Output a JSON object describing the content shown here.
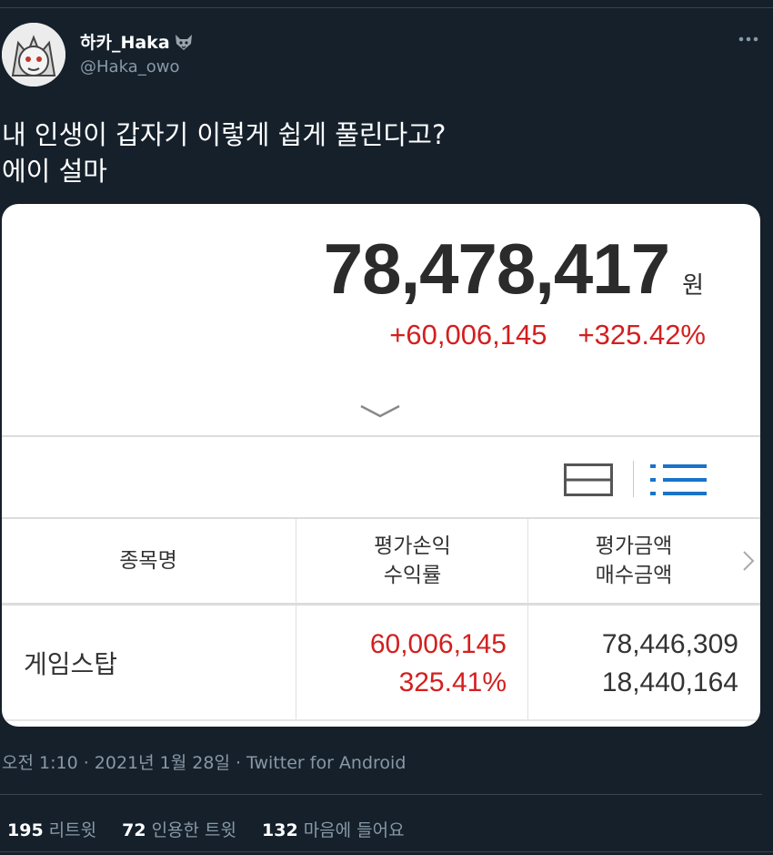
{
  "author": {
    "display_name": "하카_Haka",
    "handle": "@Haka_owo",
    "name_emoji": "wolf-icon"
  },
  "tweet": {
    "line1": "내 인생이 갑자기 이렇게 쉽게 풀린다고?",
    "line2": "에이 설마"
  },
  "card": {
    "total_amount": "78,478,417",
    "total_unit": "원",
    "change_amount": "+60,006,145",
    "change_percent": "+325.42%",
    "headers": {
      "name": "종목명",
      "pl_line1": "평가손익",
      "pl_line2": "수익률",
      "val_line1": "평가금액",
      "val_line2": "매수금액"
    },
    "rows": [
      {
        "name": "게임스탑",
        "pl_amount": "60,006,145",
        "pl_rate": "325.41%",
        "eval_amount": "78,446,309",
        "buy_amount": "18,440,164"
      }
    ],
    "colors": {
      "positive": "#d31f1f",
      "list_toggle_active": "#1a73c8",
      "grid_toggle": "#555555"
    }
  },
  "meta": {
    "timestamp": "오전 1:10 · 2021년 1월 28일 · Twitter for Android"
  },
  "stats": {
    "retweets_count": "195",
    "retweets_label": "리트윗",
    "quotes_count": "72",
    "quotes_label": "인용한 트윗",
    "likes_count": "132",
    "likes_label": "마음에 들어요"
  }
}
